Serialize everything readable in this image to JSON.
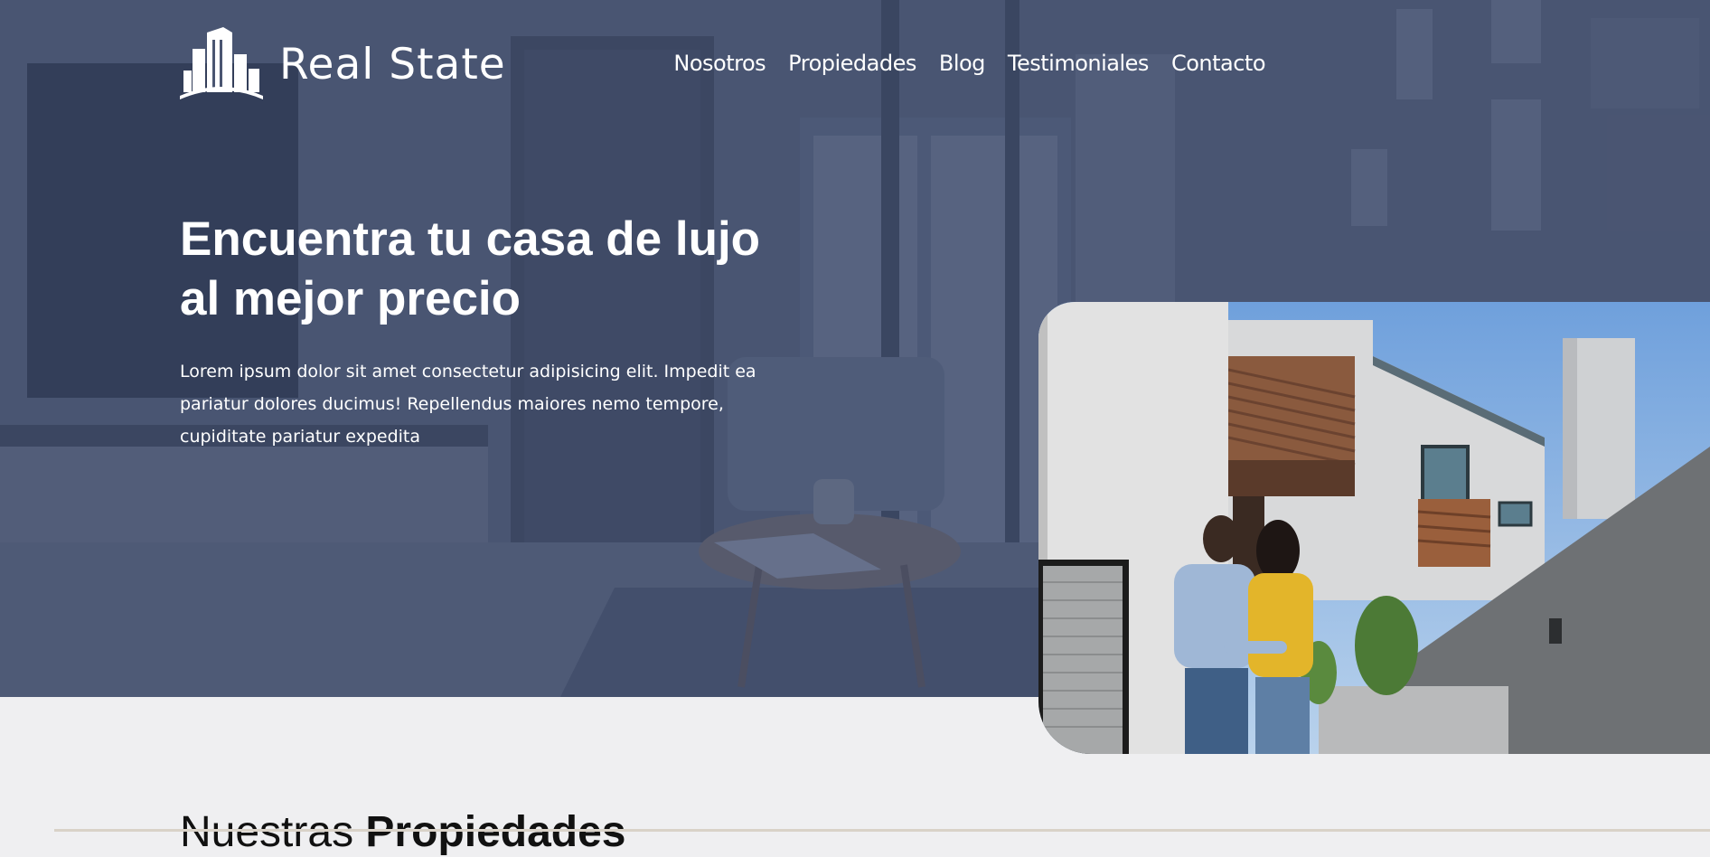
{
  "brand": {
    "name": "Real State",
    "logo_icon": "buildings-icon"
  },
  "nav": {
    "items": [
      {
        "label": "Nosotros"
      },
      {
        "label": "Propiedades"
      },
      {
        "label": "Blog"
      },
      {
        "label": "Testimoniales"
      },
      {
        "label": "Contacto"
      }
    ]
  },
  "hero": {
    "heading_line1": "Encuentra tu casa de lujo",
    "heading_line2": "al mejor precio",
    "description": "Lorem ipsum dolor sit amet consectetur adipisicing elit. Impedit ea pariatur dolores ducimus! Repellendus maiores nemo tempore, cupiditate pariatur expedita",
    "background": "living-room-photo",
    "image": "couple-looking-at-modern-house-photo"
  },
  "section": {
    "title_light": "Nuestras ",
    "title_bold": "Propiedades"
  },
  "colors": {
    "overlay": "#3a4664",
    "text": "#ffffff",
    "page_bg": "#efeff1"
  }
}
